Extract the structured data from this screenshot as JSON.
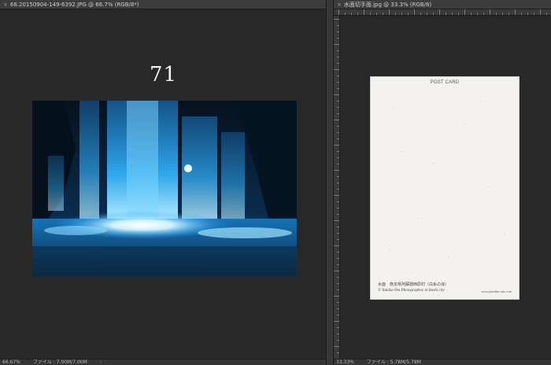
{
  "left_window": {
    "tab_title": "68.20150904-149-6392.JPG @ 66.7% (RGB/8*)",
    "close_glyph": "×",
    "doc_number": "71",
    "status": {
      "zoom": "66.67%",
      "file_info": "ファイル : 7.00M/7.00M",
      "arrow": "›"
    }
  },
  "right_window": {
    "tab_title": "水面切手面.jpg @ 33.3% (RGB/8)",
    "close_glyph": "×",
    "postcard": {
      "heading": "POST CARD",
      "caption_line": "水面　熊本県阿蘇郡西原村（白糸の滝）",
      "credit_line": "© Yumiko Ota Photographer, in Itoshi city",
      "website": "www.yumiko-ota.com"
    },
    "status": {
      "zoom": "33.33%",
      "file_info": "ファイル : 5.78M/5.78M"
    }
  },
  "colors": {
    "canvas_bg": "#282828",
    "waterfall_glow": "#7fd8ff",
    "postcard_paper": "#f4f2ef"
  }
}
